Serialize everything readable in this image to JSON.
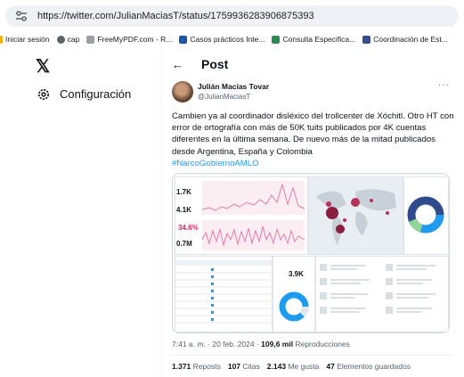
{
  "browser": {
    "url": "https://twitter.com/JulianMaciasT/status/1759936283906875393",
    "bookmarks": [
      {
        "label": "Iniciar sesión",
        "icon": "bookmark-folder-icon",
        "color": "#f0b400"
      },
      {
        "label": "cap",
        "icon": "globe-icon",
        "color": "#5f6368"
      },
      {
        "label": "FreeMyPDF.com - R...",
        "icon": "pdf-icon",
        "color": "#9aa0a6"
      },
      {
        "label": "Casos prácticos Inte...",
        "icon": "page-icon",
        "color": "#1a56a8"
      },
      {
        "label": "Consulta Especifica...",
        "icon": "page-icon",
        "color": "#2e8b57"
      },
      {
        "label": "Coordinación de Est...",
        "icon": "page-icon",
        "color": "#3b4a8c"
      }
    ]
  },
  "sidebar": {
    "logo": "𝕏",
    "settings_label": "Configuración"
  },
  "post": {
    "header_title": "Post",
    "back_glyph": "←",
    "author_name": "Julián Macías Tovar",
    "author_handle": "@JulianMaciasT",
    "more_glyph": "···",
    "text": "Cambien ya al coordinador disléxico del trollcenter de Xóchitl. Otro HT con error de ortografía con más de 50K tuits publicados por 4K cuentas diferentes en la última semana. De nuevo más de la mitad publicados desde Argentina, España y Colombia",
    "hashtag": "#NarcoGobiernoAMLO",
    "media_metrics": {
      "m1": "1.7K",
      "m2": "4.1K",
      "m3": "34.6%",
      "m4": "0.7M",
      "m5": "3.9K"
    },
    "time": "7:41 a. m. · 20 feb. 2024 · ",
    "views_count": "109,6 mil",
    "views_label": " Reproducciones",
    "stats": [
      {
        "count": "1.371",
        "label": "Reposts"
      },
      {
        "count": "107",
        "label": "Citas"
      },
      {
        "count": "2.143",
        "label": "Me gusta"
      },
      {
        "count": "47",
        "label": "Elementos guardados"
      }
    ]
  }
}
